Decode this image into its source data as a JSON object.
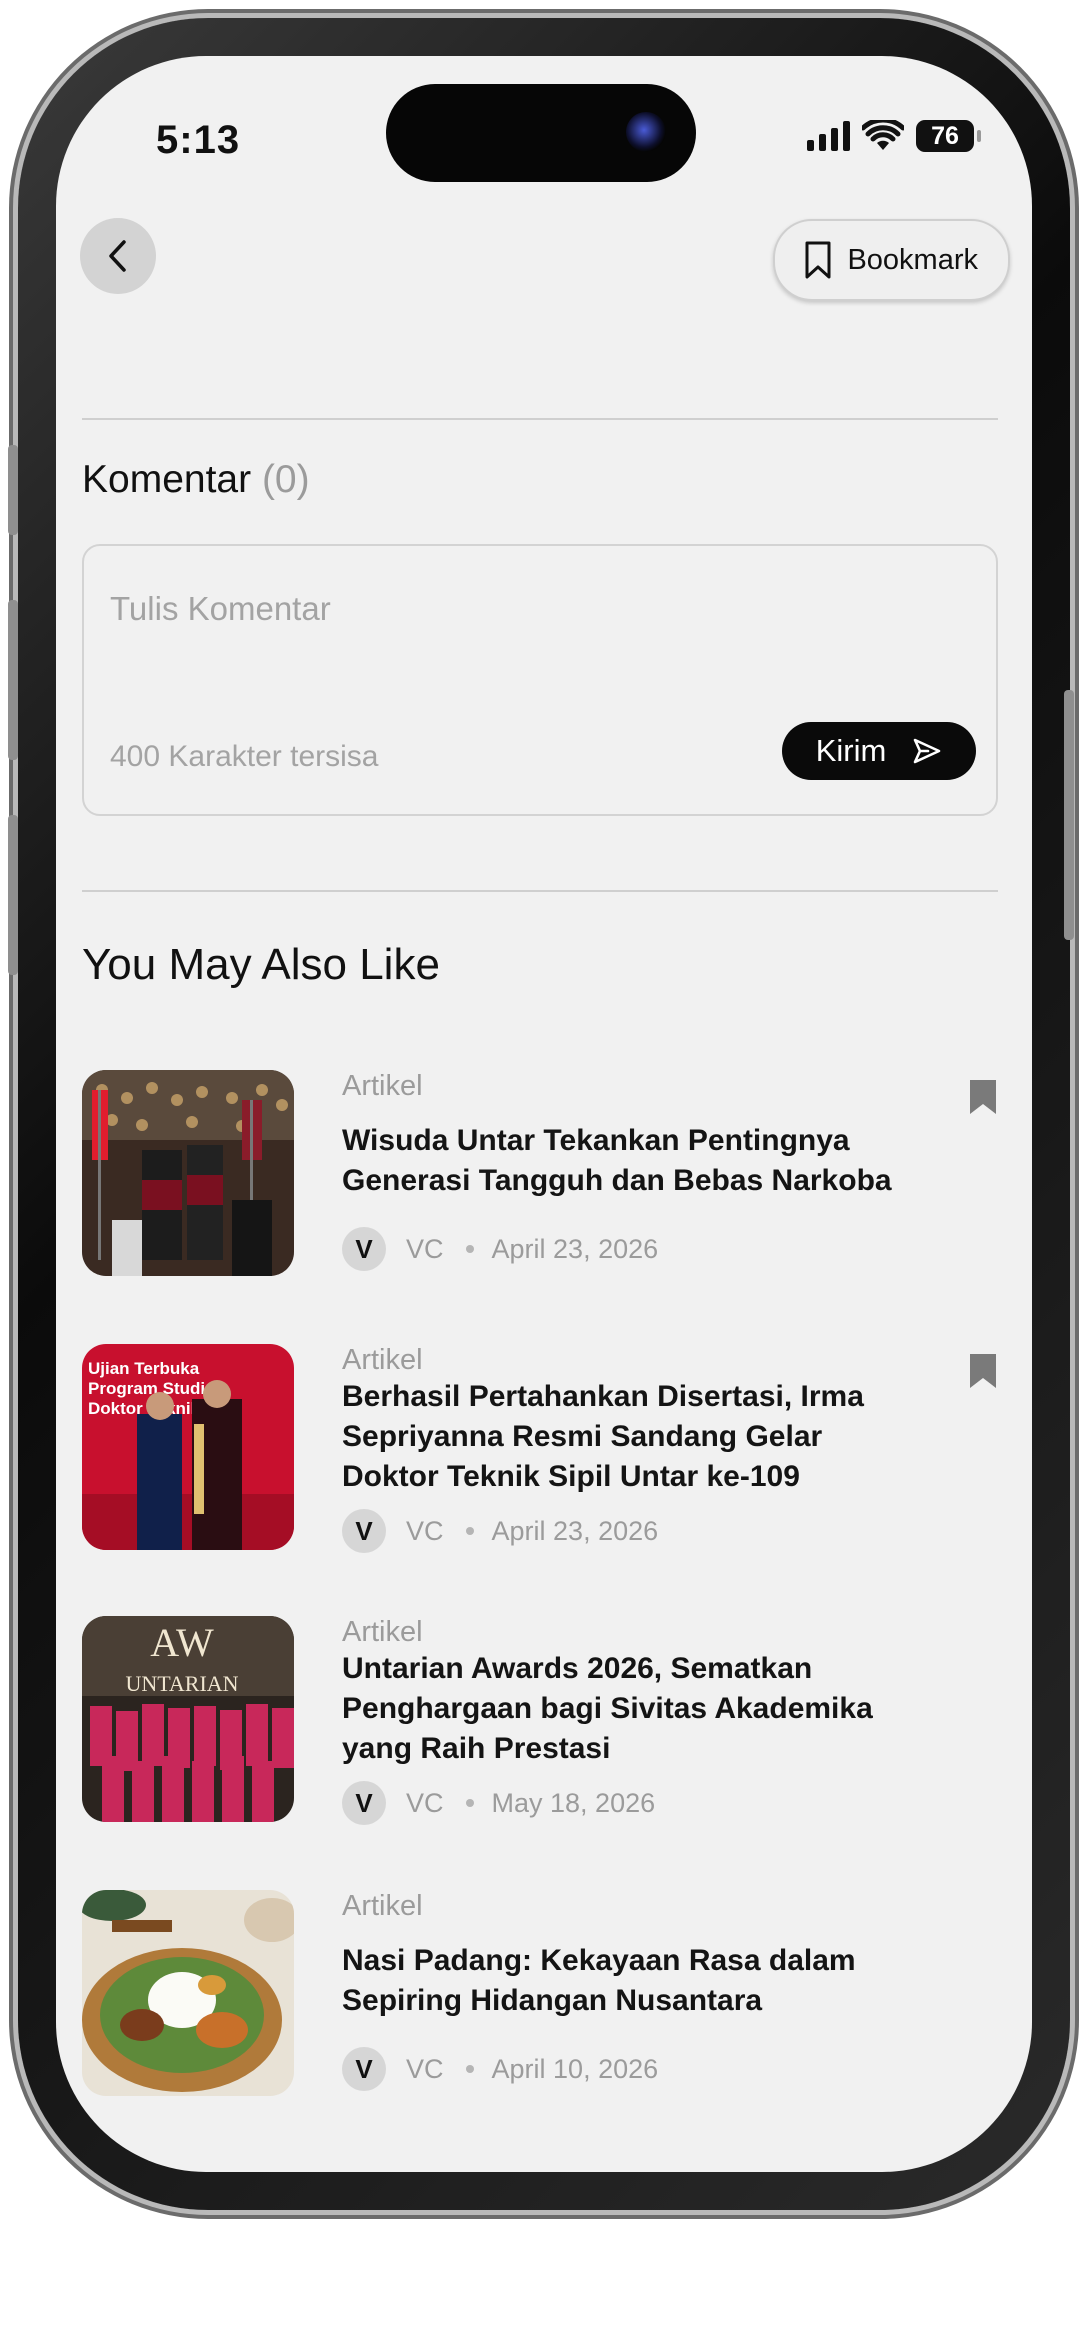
{
  "status_bar": {
    "time": "5:13",
    "battery": "76"
  },
  "header": {
    "bookmark_label": "Bookmark"
  },
  "comments": {
    "title": "Komentar",
    "count": "(0)",
    "placeholder": "Tulis Komentar",
    "chars_left": "400 Karakter tersisa",
    "send_label": "Kirim"
  },
  "recommendations": {
    "title": "You May Also Like",
    "items": [
      {
        "category": "Artikel",
        "title": "Wisuda Untar Tekankan Pentingnya Generasi Tangguh dan Bebas Narkoba",
        "author_initial": "V",
        "author": "VC",
        "date": "April 23, 2026",
        "bookmarked": true
      },
      {
        "category": "Artikel",
        "title": "Berhasil Pertahankan Disertasi, Irma Sepriyanna Resmi Sandang Gelar Doktor Teknik Sipil Untar ke-109",
        "author_initial": "V",
        "author": "VC",
        "date": "April 23, 2026",
        "bookmarked": true,
        "image_text": "Ujian Terbuka Program Studi Doktor Teknik"
      },
      {
        "category": "Artikel",
        "title": "Untarian Awards 2026, Sematkan Penghargaan bagi Sivitas Akademika yang Raih Prestasi",
        "author_initial": "V",
        "author": "VC",
        "date": "May 18, 2026",
        "bookmarked": false,
        "image_text": "AW UNTARIAN"
      },
      {
        "category": "Artikel",
        "title": "Nasi Padang: Kekayaan Rasa dalam Sepiring Hidangan Nusantara",
        "author_initial": "V",
        "author": "VC",
        "date": "April 10, 2026",
        "bookmarked": false
      }
    ]
  }
}
